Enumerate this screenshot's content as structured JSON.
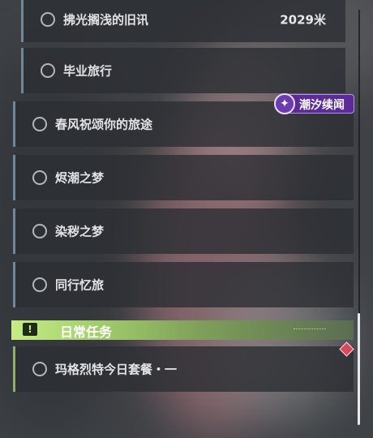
{
  "quests": [
    {
      "label": "拂光搁浅的旧讯",
      "distance": "2029米"
    },
    {
      "label": "毕业旅行"
    },
    {
      "label": "春风祝颂你的旅途"
    },
    {
      "label": "烬潮之梦"
    },
    {
      "label": "染秽之梦"
    },
    {
      "label": "同行忆旅"
    }
  ],
  "event_tag": {
    "label": "潮汐续闻",
    "icon": "tide-emblem-icon"
  },
  "daily_section": {
    "title": "日常任务",
    "icon": "exclamation-icon",
    "quest": {
      "label": "玛格烈特今日套餐・一"
    }
  },
  "colors": {
    "quest_accent": "#6f8797",
    "daily_accent": "#a9d46f",
    "event_tag": "#5a2c95",
    "marker": "#d84a5a"
  }
}
